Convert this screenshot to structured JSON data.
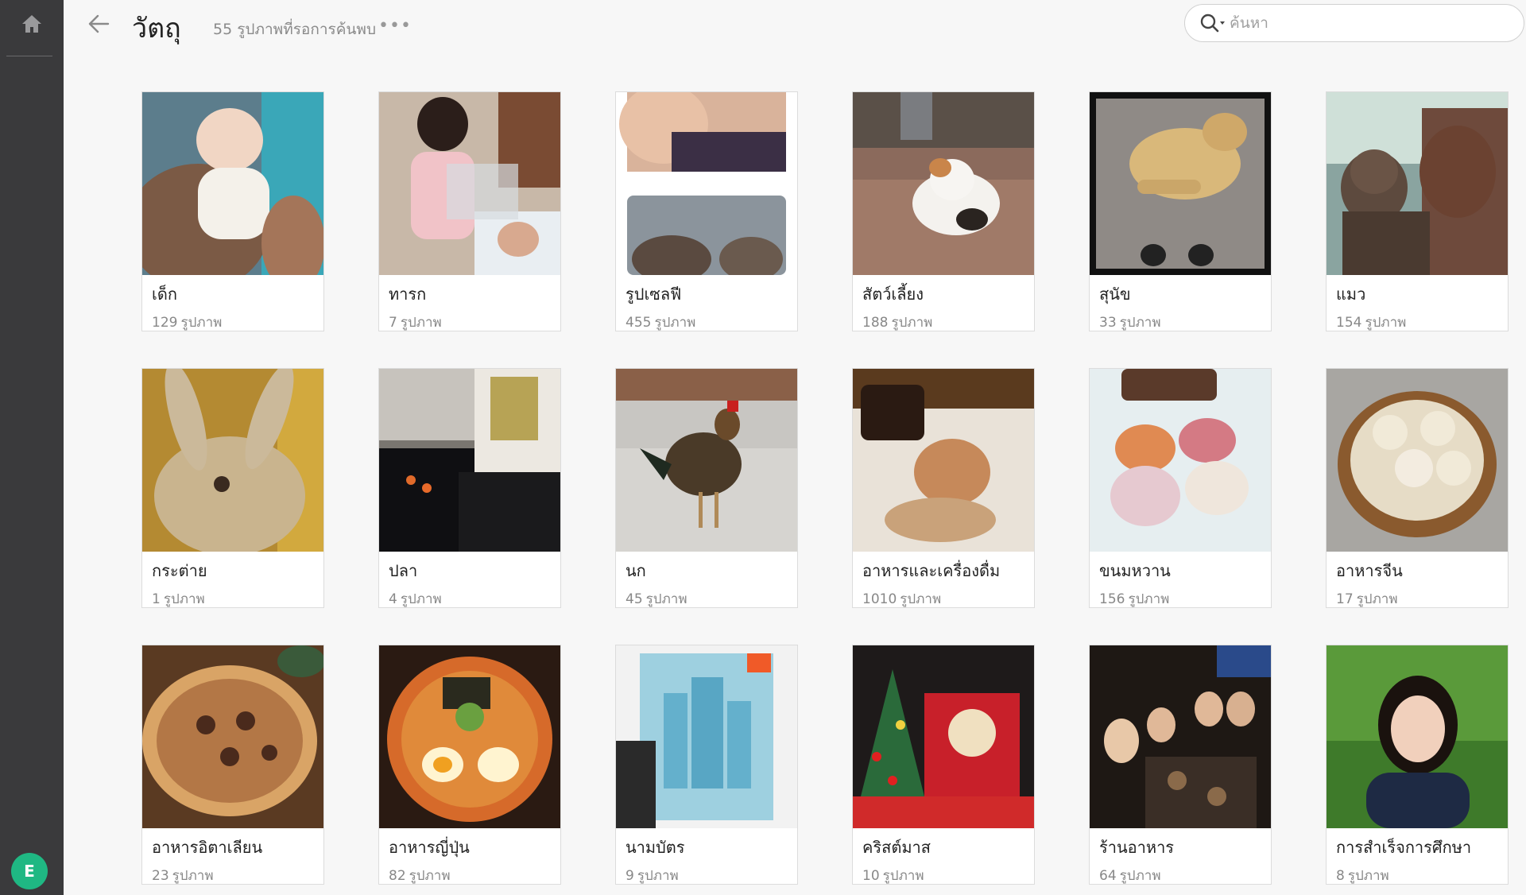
{
  "sidebar": {
    "avatar_letter": "E"
  },
  "header": {
    "title": "วัตถุ",
    "subtitle": "55 รูปภาพที่รอการค้นพบ",
    "more": "•••"
  },
  "search": {
    "placeholder": "ค้นหา"
  },
  "unit": "รูปภาพ",
  "albums": [
    {
      "label": "เด็ก",
      "count": "129",
      "thumb": "baby"
    },
    {
      "label": "ทารก",
      "count": "7",
      "thumb": "newborn"
    },
    {
      "label": "รูปเซลฟี",
      "count": "455",
      "thumb": "selfie"
    },
    {
      "label": "สัตว์เลี้ยง",
      "count": "188",
      "thumb": "pet"
    },
    {
      "label": "สุนัข",
      "count": "33",
      "thumb": "dog"
    },
    {
      "label": "แมว",
      "count": "154",
      "thumb": "cat"
    },
    {
      "label": "กระต่าย",
      "count": "1",
      "thumb": "rabbit"
    },
    {
      "label": "ปลา",
      "count": "4",
      "thumb": "fish"
    },
    {
      "label": "นก",
      "count": "45",
      "thumb": "bird"
    },
    {
      "label": "อาหารและเครื่องดื่ม",
      "count": "1010",
      "thumb": "food"
    },
    {
      "label": "ขนมหวาน",
      "count": "156",
      "thumb": "dessert"
    },
    {
      "label": "อาหารจีน",
      "count": "17",
      "thumb": "dimsum"
    },
    {
      "label": "อาหารอิตาเลียน",
      "count": "23",
      "thumb": "pizza"
    },
    {
      "label": "อาหารญี่ปุ่น",
      "count": "82",
      "thumb": "ramen"
    },
    {
      "label": "นามบัตร",
      "count": "9",
      "thumb": "card"
    },
    {
      "label": "คริสต์มาส",
      "count": "10",
      "thumb": "xmas"
    },
    {
      "label": "ร้านอาหาร",
      "count": "64",
      "thumb": "restaurant"
    },
    {
      "label": "การสำเร็จการศึกษา",
      "count": "8",
      "thumb": "graduation"
    }
  ]
}
